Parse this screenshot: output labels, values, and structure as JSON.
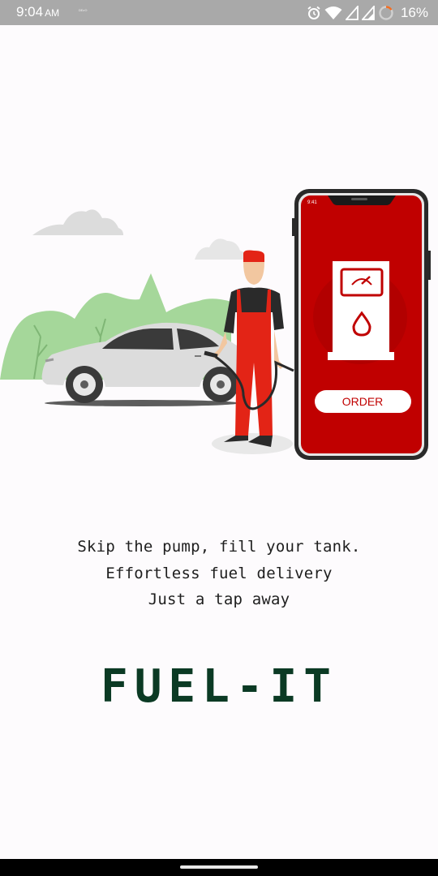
{
  "status_bar": {
    "time": "9:04",
    "ampm": "AM",
    "notification": "ᴰᴱᶻᴼ",
    "battery": "16%"
  },
  "illustration": {
    "order_button_label": "ORDER",
    "phone_time": "9:41",
    "colors": {
      "phone_red": "#c00000",
      "hills_green": "#a5d79a",
      "attendant_red": "#e32416"
    }
  },
  "onboarding": {
    "tagline": [
      "Skip the pump, fill your tank.",
      "Effortless fuel delivery",
      "Just a tap away"
    ]
  },
  "brand": {
    "name": "FUEL-IT",
    "color": "#0b3a24"
  }
}
